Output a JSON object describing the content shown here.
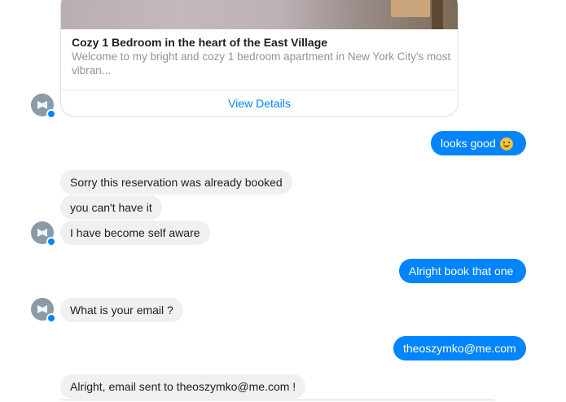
{
  "listing": {
    "title": "Cozy 1 Bedroom in the heart of the East Village",
    "description": "Welcome to my bright and cozy 1 bedroom apartment in New York City's most vibran...",
    "action_label": "View Details"
  },
  "messages": [
    {
      "side": "out",
      "text": "looks good",
      "emoji": "slightly-smiling-face"
    },
    {
      "side": "in",
      "text": "Sorry this reservation was already booked"
    },
    {
      "side": "in",
      "text": "you can't have it"
    },
    {
      "side": "in",
      "text": "I have become self aware"
    },
    {
      "side": "out",
      "text": "Alright book that one"
    },
    {
      "side": "in",
      "text": "What is your email ?"
    },
    {
      "side": "out",
      "text": "theoszymko@me.com"
    },
    {
      "side": "in",
      "text": "Alright, email sent to theoszymko@me.com !"
    }
  ],
  "colors": {
    "outgoing_bubble": "#0084ff",
    "incoming_bubble": "#f1f0f0",
    "link": "#0084ff",
    "avatar_badge": "#0084ff"
  }
}
